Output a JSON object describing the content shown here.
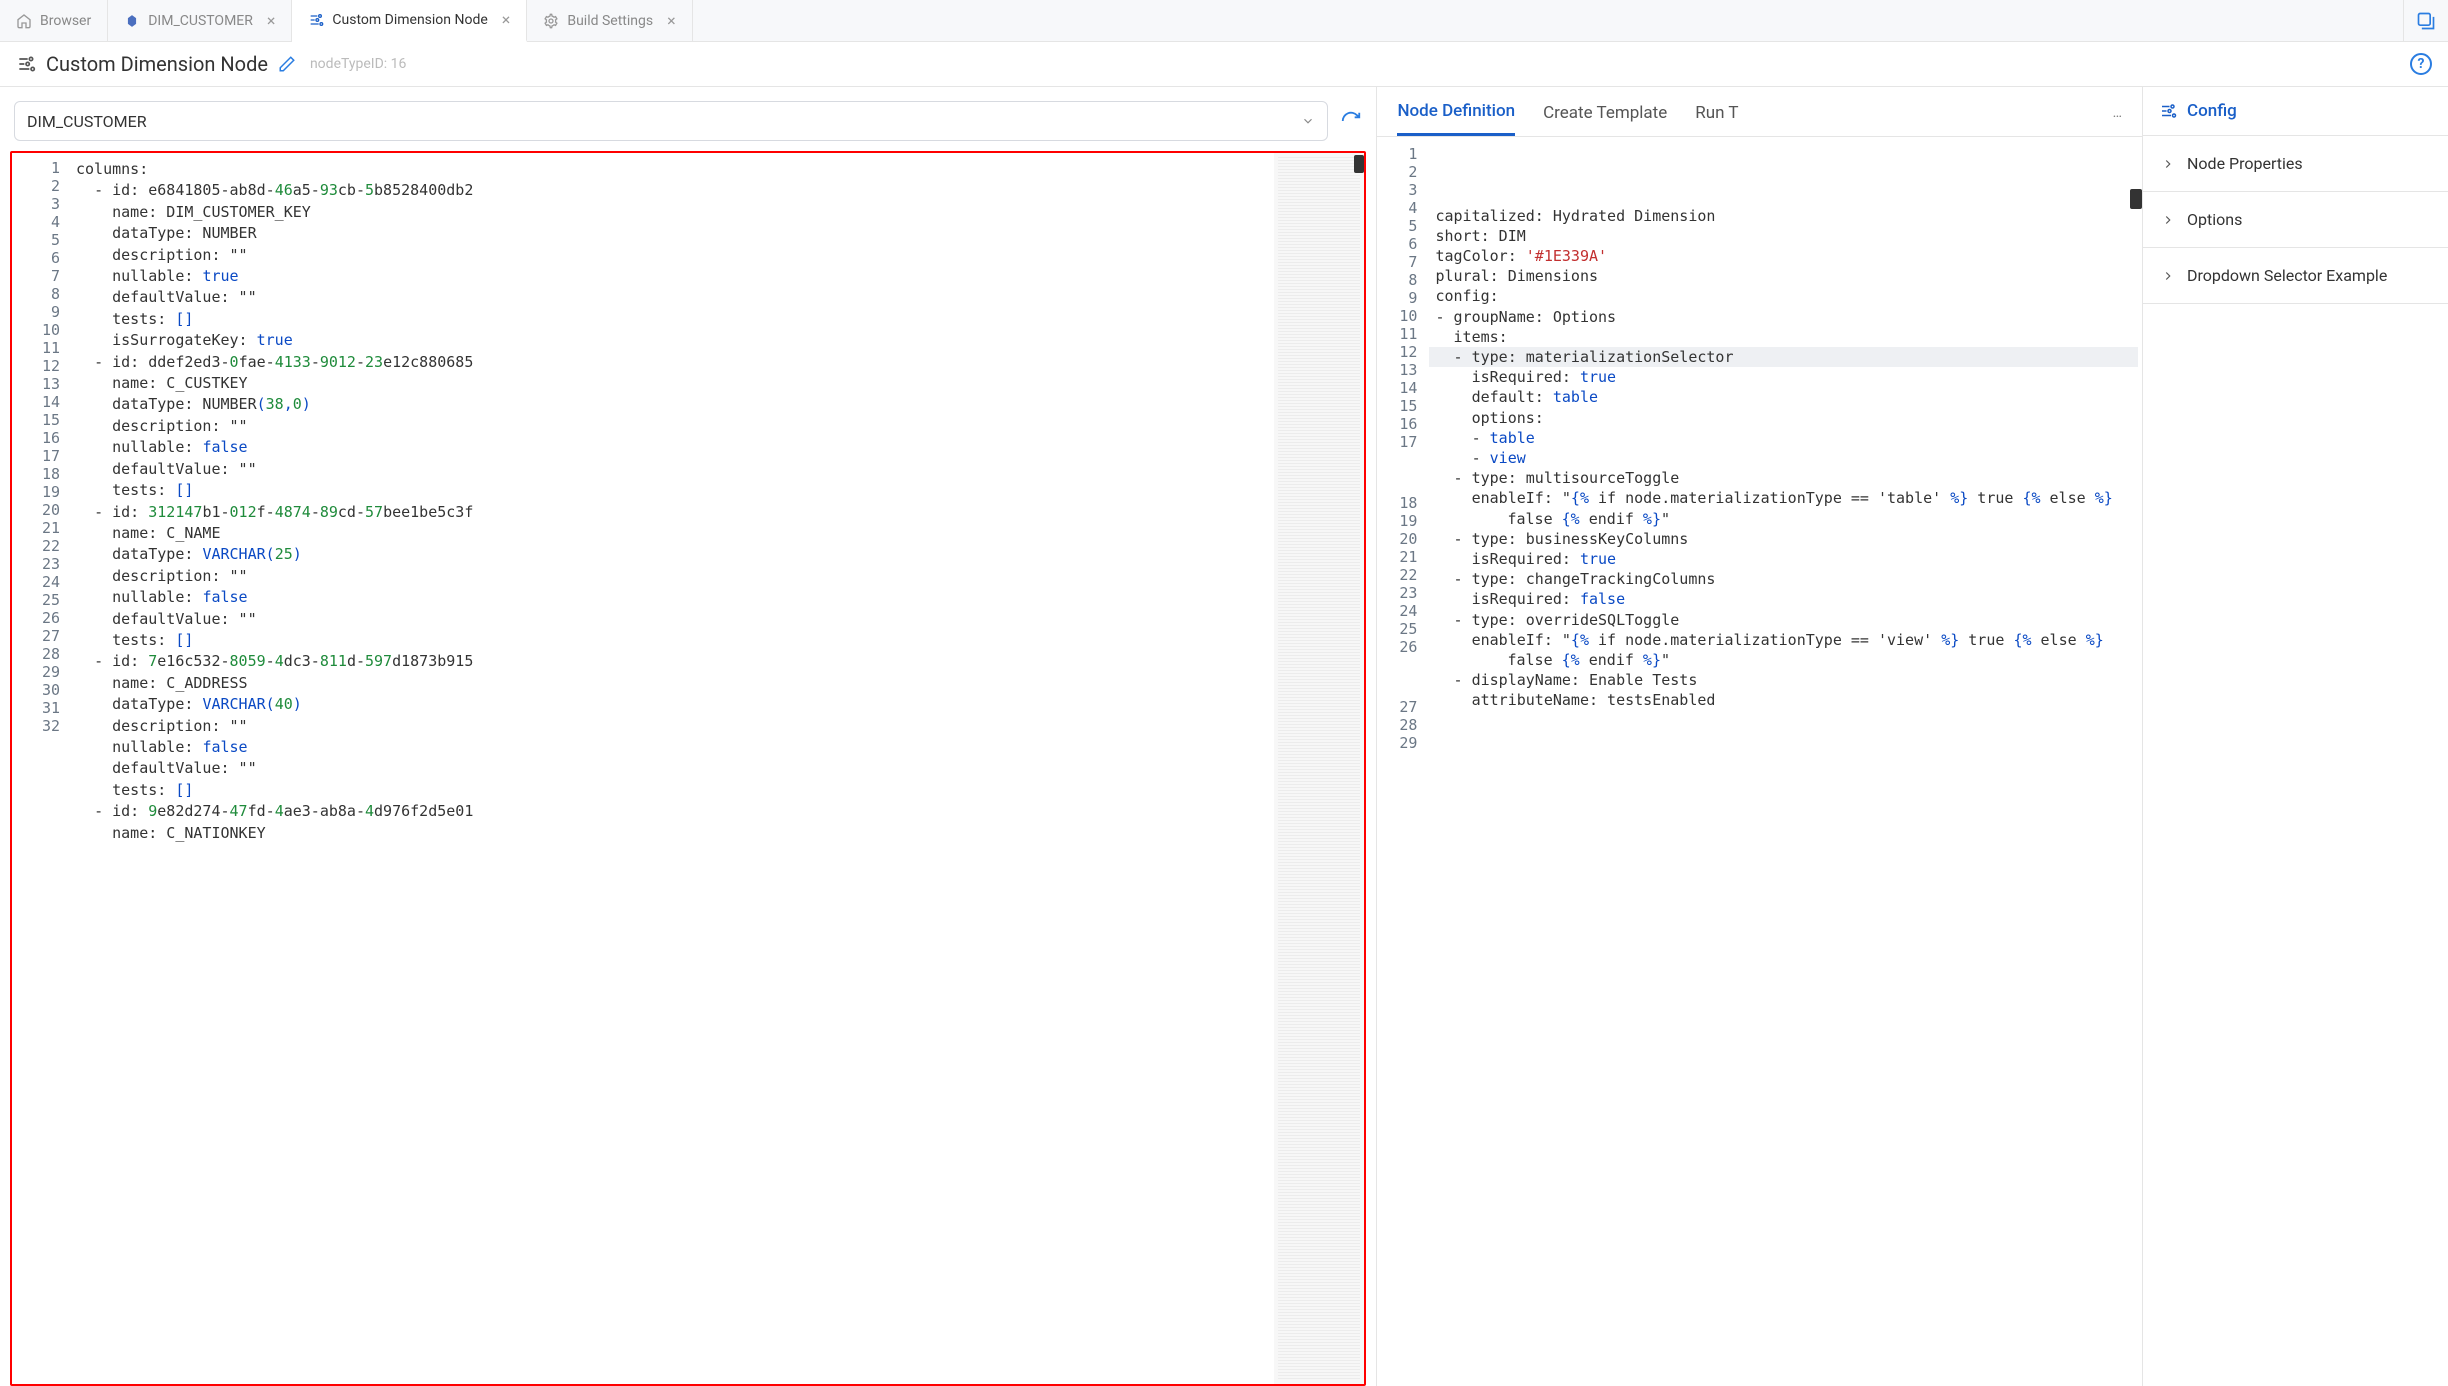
{
  "tabs": [
    {
      "label": "Browser",
      "icon": "home-icon",
      "closable": false,
      "active": false
    },
    {
      "label": "DIM_CUSTOMER",
      "icon": "db-obj-icon",
      "closable": true,
      "active": false
    },
    {
      "label": "Custom Dimension Node",
      "icon": "sliders-icon",
      "closable": true,
      "active": true
    },
    {
      "label": "Build Settings",
      "icon": "gear-icon",
      "closable": true,
      "active": false
    }
  ],
  "header": {
    "icon": "sliders-icon",
    "title": "Custom Dimension Node",
    "meta": "nodeTypeID: 16"
  },
  "selector": {
    "value": "DIM_CUSTOMER"
  },
  "left_editor": {
    "lines": [
      {
        "n": 1,
        "i": 0,
        "d": false,
        "segs": [
          [
            "columns:",
            "key"
          ]
        ]
      },
      {
        "n": 2,
        "i": 1,
        "d": true,
        "segs": [
          [
            "id: ",
            "key"
          ],
          [
            "e6841805",
            "txt"
          ],
          [
            "-ab8d-",
            "txt"
          ],
          [
            "46",
            "num"
          ],
          [
            "a5-",
            "txt"
          ],
          [
            "93",
            "num"
          ],
          [
            "cb-",
            "txt"
          ],
          [
            "5",
            "num"
          ],
          [
            "b8528400db2",
            "txt"
          ]
        ]
      },
      {
        "n": 3,
        "i": 2,
        "d": false,
        "segs": [
          [
            "name: DIM_CUSTOMER_KEY",
            "key"
          ]
        ]
      },
      {
        "n": 4,
        "i": 2,
        "d": false,
        "segs": [
          [
            "dataType: NUMBER",
            "key"
          ]
        ]
      },
      {
        "n": 5,
        "i": 2,
        "d": false,
        "segs": [
          [
            "description: \"\"",
            "key"
          ]
        ]
      },
      {
        "n": 6,
        "i": 2,
        "d": false,
        "segs": [
          [
            "nullable: ",
            "key"
          ],
          [
            "true",
            "bool"
          ]
        ]
      },
      {
        "n": 7,
        "i": 2,
        "d": false,
        "segs": [
          [
            "defaultValue: \"\"",
            "key"
          ]
        ]
      },
      {
        "n": 8,
        "i": 2,
        "d": false,
        "segs": [
          [
            "tests: ",
            "key"
          ],
          [
            "[]",
            "type"
          ]
        ]
      },
      {
        "n": 9,
        "i": 2,
        "d": false,
        "segs": [
          [
            "isSurrogateKey: ",
            "key"
          ],
          [
            "true",
            "bool"
          ]
        ]
      },
      {
        "n": 10,
        "i": 1,
        "d": true,
        "segs": [
          [
            "id: ",
            "key"
          ],
          [
            "ddef2ed3-",
            "txt"
          ],
          [
            "0",
            "num"
          ],
          [
            "fae-",
            "txt"
          ],
          [
            "4133",
            "num"
          ],
          [
            "-",
            "txt"
          ],
          [
            "9012",
            "num"
          ],
          [
            "-",
            "txt"
          ],
          [
            "23",
            "num"
          ],
          [
            "e12",
            "txt"
          ],
          [
            "c880685",
            "txt"
          ]
        ]
      },
      {
        "n": 11,
        "i": 2,
        "d": false,
        "segs": [
          [
            "name: C_CUSTKEY",
            "key"
          ]
        ]
      },
      {
        "n": 12,
        "i": 2,
        "d": false,
        "segs": [
          [
            "dataType: NUMBER",
            "key"
          ],
          [
            "(",
            "type"
          ],
          [
            "38",
            "num"
          ],
          [
            ",",
            "type"
          ],
          [
            "0",
            "num"
          ],
          [
            ")",
            "type"
          ]
        ]
      },
      {
        "n": 13,
        "i": 2,
        "d": false,
        "segs": [
          [
            "description: \"\"",
            "key"
          ]
        ]
      },
      {
        "n": 14,
        "i": 2,
        "d": false,
        "segs": [
          [
            "nullable: ",
            "key"
          ],
          [
            "false",
            "bool"
          ]
        ]
      },
      {
        "n": 15,
        "i": 2,
        "d": false,
        "segs": [
          [
            "defaultValue: \"\"",
            "key"
          ]
        ]
      },
      {
        "n": 16,
        "i": 2,
        "d": false,
        "segs": [
          [
            "tests: ",
            "key"
          ],
          [
            "[]",
            "type"
          ]
        ]
      },
      {
        "n": 17,
        "i": 1,
        "d": true,
        "segs": [
          [
            "id: ",
            "key"
          ],
          [
            "312147",
            "num"
          ],
          [
            "b1-",
            "txt"
          ],
          [
            "012",
            "num"
          ],
          [
            "f-",
            "txt"
          ],
          [
            "4874",
            "num"
          ],
          [
            "-",
            "txt"
          ],
          [
            "89",
            "num"
          ],
          [
            "cd-",
            "txt"
          ],
          [
            "57",
            "num"
          ],
          [
            "bee1be5c3f",
            "txt"
          ]
        ]
      },
      {
        "n": 18,
        "i": 2,
        "d": false,
        "segs": [
          [
            "name: C_NAME",
            "key"
          ]
        ]
      },
      {
        "n": 19,
        "i": 2,
        "d": false,
        "segs": [
          [
            "dataType: ",
            "key"
          ],
          [
            "VARCHAR",
            "type"
          ],
          [
            "(",
            "type"
          ],
          [
            "25",
            "num"
          ],
          [
            ")",
            "type"
          ]
        ]
      },
      {
        "n": 20,
        "i": 2,
        "d": false,
        "segs": [
          [
            "description: \"\"",
            "key"
          ]
        ]
      },
      {
        "n": 21,
        "i": 2,
        "d": false,
        "segs": [
          [
            "nullable: ",
            "key"
          ],
          [
            "false",
            "bool"
          ]
        ]
      },
      {
        "n": 22,
        "i": 2,
        "d": false,
        "segs": [
          [
            "defaultValue: \"\"",
            "key"
          ]
        ]
      },
      {
        "n": 23,
        "i": 2,
        "d": false,
        "segs": [
          [
            "tests: ",
            "key"
          ],
          [
            "[]",
            "type"
          ]
        ]
      },
      {
        "n": 24,
        "i": 1,
        "d": true,
        "segs": [
          [
            "id: ",
            "key"
          ],
          [
            "7",
            "num"
          ],
          [
            "e16",
            "txt"
          ],
          [
            "c532-",
            "txt"
          ],
          [
            "8059",
            "num"
          ],
          [
            "-",
            "txt"
          ],
          [
            "4",
            "num"
          ],
          [
            "dc3-",
            "txt"
          ],
          [
            "811",
            "num"
          ],
          [
            "d-",
            "txt"
          ],
          [
            "597",
            "num"
          ],
          [
            "d1873b915",
            "txt"
          ]
        ]
      },
      {
        "n": 25,
        "i": 2,
        "d": false,
        "segs": [
          [
            "name: C_ADDRESS",
            "key"
          ]
        ]
      },
      {
        "n": 26,
        "i": 2,
        "d": false,
        "segs": [
          [
            "dataType: ",
            "key"
          ],
          [
            "VARCHAR",
            "type"
          ],
          [
            "(",
            "type"
          ],
          [
            "40",
            "num"
          ],
          [
            ")",
            "type"
          ]
        ]
      },
      {
        "n": 27,
        "i": 2,
        "d": false,
        "segs": [
          [
            "description: \"\"",
            "key"
          ]
        ]
      },
      {
        "n": 28,
        "i": 2,
        "d": false,
        "segs": [
          [
            "nullable: ",
            "key"
          ],
          [
            "false",
            "bool"
          ]
        ]
      },
      {
        "n": 29,
        "i": 2,
        "d": false,
        "segs": [
          [
            "defaultValue: \"\"",
            "key"
          ]
        ]
      },
      {
        "n": 30,
        "i": 2,
        "d": false,
        "segs": [
          [
            "tests: ",
            "key"
          ],
          [
            "[]",
            "type"
          ]
        ]
      },
      {
        "n": 31,
        "i": 1,
        "d": true,
        "segs": [
          [
            "id: ",
            "key"
          ],
          [
            "9",
            "num"
          ],
          [
            "e82",
            "txt"
          ],
          [
            "d274-",
            "txt"
          ],
          [
            "47",
            "num"
          ],
          [
            "fd-",
            "txt"
          ],
          [
            "4",
            "num"
          ],
          [
            "ae3-ab8a-",
            "txt"
          ],
          [
            "4",
            "num"
          ],
          [
            "d976f2d5e01",
            "txt"
          ]
        ]
      },
      {
        "n": 32,
        "i": 2,
        "d": false,
        "segs": [
          [
            "name: C_NATIONKEY",
            "key"
          ]
        ]
      }
    ]
  },
  "mid": {
    "tabs": [
      {
        "label": "Node Definition",
        "active": true
      },
      {
        "label": "Create Template",
        "active": false
      },
      {
        "label": "Run T",
        "active": false
      }
    ],
    "more": "…",
    "lines": [
      {
        "n": 1,
        "i": 0,
        "d": false,
        "hl": false,
        "segs": [
          [
            "capitalized: Hydrated Dimension",
            "key"
          ]
        ]
      },
      {
        "n": 2,
        "i": 0,
        "d": false,
        "hl": false,
        "segs": [
          [
            "short: DIM",
            "key"
          ]
        ]
      },
      {
        "n": 3,
        "i": 0,
        "d": false,
        "hl": false,
        "segs": [
          [
            "tagColor: ",
            "key"
          ],
          [
            "'#1E339A'",
            "str"
          ]
        ]
      },
      {
        "n": 4,
        "i": 0,
        "d": false,
        "hl": false,
        "segs": [
          [
            "plural: Dimensions",
            "key"
          ]
        ]
      },
      {
        "n": 5,
        "i": 0,
        "d": false,
        "hl": false,
        "segs": [
          [
            "",
            "key"
          ]
        ]
      },
      {
        "n": 6,
        "i": 0,
        "d": false,
        "hl": false,
        "segs": [
          [
            "config:",
            "key"
          ]
        ]
      },
      {
        "n": 7,
        "i": 0,
        "d": true,
        "hl": false,
        "segs": [
          [
            "groupName: Options",
            "key"
          ]
        ]
      },
      {
        "n": 8,
        "i": 1,
        "d": false,
        "hl": false,
        "segs": [
          [
            "items:",
            "key"
          ]
        ]
      },
      {
        "n": 9,
        "i": 1,
        "d": true,
        "hl": true,
        "segs": [
          [
            "type: materializationSelector",
            "key"
          ]
        ]
      },
      {
        "n": 10,
        "i": 2,
        "d": false,
        "hl": false,
        "segs": [
          [
            "isRequired: ",
            "key"
          ],
          [
            "true",
            "bool"
          ]
        ]
      },
      {
        "n": 11,
        "i": 2,
        "d": false,
        "hl": false,
        "segs": [
          [
            "default: ",
            "key"
          ],
          [
            "table",
            "bool"
          ]
        ]
      },
      {
        "n": 12,
        "i": 2,
        "d": false,
        "hl": false,
        "segs": [
          [
            "options:",
            "key"
          ]
        ]
      },
      {
        "n": 13,
        "i": 2,
        "d": true,
        "hl": false,
        "segs": [
          [
            "table",
            "bool"
          ]
        ]
      },
      {
        "n": 14,
        "i": 2,
        "d": true,
        "hl": false,
        "segs": [
          [
            "view",
            "bool"
          ]
        ]
      },
      {
        "n": 15,
        "i": 0,
        "d": false,
        "hl": false,
        "segs": [
          [
            "",
            "key"
          ]
        ]
      },
      {
        "n": 16,
        "i": 1,
        "d": true,
        "hl": false,
        "segs": [
          [
            "type: multisourceToggle",
            "key"
          ]
        ]
      },
      {
        "n": 17,
        "i": 2,
        "d": false,
        "hl": false,
        "wrap": true,
        "segs": [
          [
            "enableIf: \"",
            "key"
          ],
          [
            "{%",
            "tmpl"
          ],
          [
            " if node.materializationType == 'table' ",
            "key"
          ],
          [
            "%}",
            "tmpl"
          ],
          [
            " true ",
            "key"
          ],
          [
            "{%",
            "tmpl"
          ],
          [
            " else ",
            "key"
          ],
          [
            "%}",
            "tmpl"
          ],
          [
            " false ",
            "key"
          ],
          [
            "{%",
            "tmpl"
          ],
          [
            " endif ",
            "key"
          ],
          [
            "%}",
            "tmpl"
          ],
          [
            "\"",
            "key"
          ]
        ]
      },
      {
        "n": 18,
        "i": 0,
        "d": false,
        "hl": false,
        "segs": [
          [
            "",
            "key"
          ]
        ]
      },
      {
        "n": 19,
        "i": 1,
        "d": true,
        "hl": false,
        "segs": [
          [
            "type: businessKeyColumns",
            "key"
          ]
        ]
      },
      {
        "n": 20,
        "i": 2,
        "d": false,
        "hl": false,
        "segs": [
          [
            "isRequired: ",
            "key"
          ],
          [
            "true",
            "bool"
          ]
        ]
      },
      {
        "n": 21,
        "i": 0,
        "d": false,
        "hl": false,
        "segs": [
          [
            "",
            "key"
          ]
        ]
      },
      {
        "n": 22,
        "i": 1,
        "d": true,
        "hl": false,
        "segs": [
          [
            "type: changeTrackingColumns",
            "key"
          ]
        ]
      },
      {
        "n": 23,
        "i": 2,
        "d": false,
        "hl": false,
        "segs": [
          [
            "isRequired: ",
            "key"
          ],
          [
            "false",
            "bool"
          ]
        ]
      },
      {
        "n": 24,
        "i": 0,
        "d": false,
        "hl": false,
        "segs": [
          [
            "",
            "key"
          ]
        ]
      },
      {
        "n": 25,
        "i": 1,
        "d": true,
        "hl": false,
        "segs": [
          [
            "type: overrideSQLToggle",
            "key"
          ]
        ]
      },
      {
        "n": 26,
        "i": 2,
        "d": false,
        "hl": false,
        "wrap": true,
        "segs": [
          [
            "enableIf: \"",
            "key"
          ],
          [
            "{%",
            "tmpl"
          ],
          [
            " if node.materializationType == 'view' ",
            "key"
          ],
          [
            "%}",
            "tmpl"
          ],
          [
            " true ",
            "key"
          ],
          [
            "{%",
            "tmpl"
          ],
          [
            " else ",
            "key"
          ],
          [
            "%}",
            "tmpl"
          ],
          [
            " false ",
            "key"
          ],
          [
            "{%",
            "tmpl"
          ],
          [
            " endif ",
            "key"
          ],
          [
            "%}",
            "tmpl"
          ],
          [
            "\"",
            "key"
          ]
        ]
      },
      {
        "n": 27,
        "i": 0,
        "d": false,
        "hl": false,
        "segs": [
          [
            "",
            "key"
          ]
        ]
      },
      {
        "n": 28,
        "i": 1,
        "d": true,
        "hl": false,
        "segs": [
          [
            "displayName: Enable Tests",
            "key"
          ]
        ]
      },
      {
        "n": 29,
        "i": 2,
        "d": false,
        "hl": false,
        "segs": [
          [
            "attributeName: testsEnabled",
            "key"
          ]
        ]
      }
    ]
  },
  "right": {
    "title": "Config",
    "items": [
      "Node Properties",
      "Options",
      "Dropdown Selector Example"
    ]
  }
}
